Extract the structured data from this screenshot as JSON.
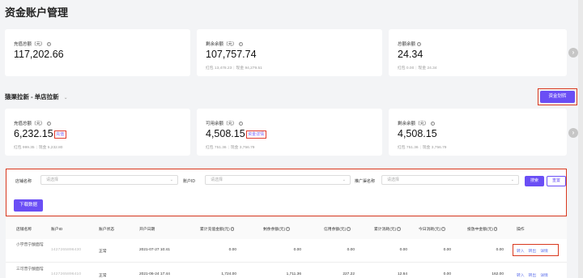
{
  "page": {
    "title": "资金账户管理"
  },
  "summary_cards": [
    {
      "label": "充值总额（元）",
      "value": "117,202.66"
    },
    {
      "label": "剩余余额（元）",
      "value": "107,757.74",
      "sub_red": "红包 13,478.23",
      "sub_cash": "现金 94,279.51"
    },
    {
      "label": "总额余额",
      "value": "24.34",
      "sub_red": "红包 0.00",
      "sub_cash": "现金 24.34"
    }
  ],
  "section": {
    "title": "猿渠拉新 - 单店拉新",
    "transfer_button": "资金划转"
  },
  "detail_cards": [
    {
      "label": "充值总额（元）",
      "value": "6,232.15",
      "tag": "充值",
      "sub_red": "红包 999.35",
      "sub_cash": "现金 5,232.80"
    },
    {
      "label": "可用余额（元）",
      "value": "4,508.15",
      "tag": "资金详情",
      "sub_red": "红包 751.36",
      "sub_cash": "现金 3,756.79"
    },
    {
      "label": "剩余余额（元）",
      "value": "4,508.15",
      "sub_red": "红包 751.36",
      "sub_cash": "现金 3,756.79"
    }
  ],
  "filters": {
    "store_label": "店铺名称",
    "store_placeholder": "请选择",
    "account_label": "账户ID",
    "account_placeholder": "请选择",
    "channel_label": "推广渠名称",
    "channel_placeholder": "请选择",
    "search_button": "搜索",
    "reset_button": "重置",
    "download_button": "下载数据"
  },
  "table": {
    "columns": [
      "店铺名称",
      "账户ID",
      "账户状态",
      "开户日期",
      "累计充值金额(元)",
      "剩余余额(元)",
      "信用余额(元)",
      "累计消耗(元)",
      "今日消耗(元)",
      "投放中金额(元)",
      "操作"
    ],
    "rows": [
      {
        "store": "小学普宁酸面馆",
        "account_id": "1427265896430",
        "status": "正常",
        "date": "2021-07-27 10:41",
        "recharge": "0.00",
        "balance": "0.00",
        "credit": "0.00",
        "consumed": "0.00",
        "today": "0.00",
        "delivering": "0.00",
        "ops": [
          "转入",
          "转出",
          "详情"
        ]
      },
      {
        "store": "三可普宁酸面馆",
        "account_id": "1427265896410",
        "status": "正常",
        "date": "2021-06-24 17:44",
        "recharge": "1,724.00",
        "balance": "1,711.36",
        "credit": "227.22",
        "consumed": "12.64",
        "today": "0.00",
        "delivering": "162.00",
        "ops": [
          "转入",
          "转出",
          "详情"
        ]
      }
    ]
  }
}
